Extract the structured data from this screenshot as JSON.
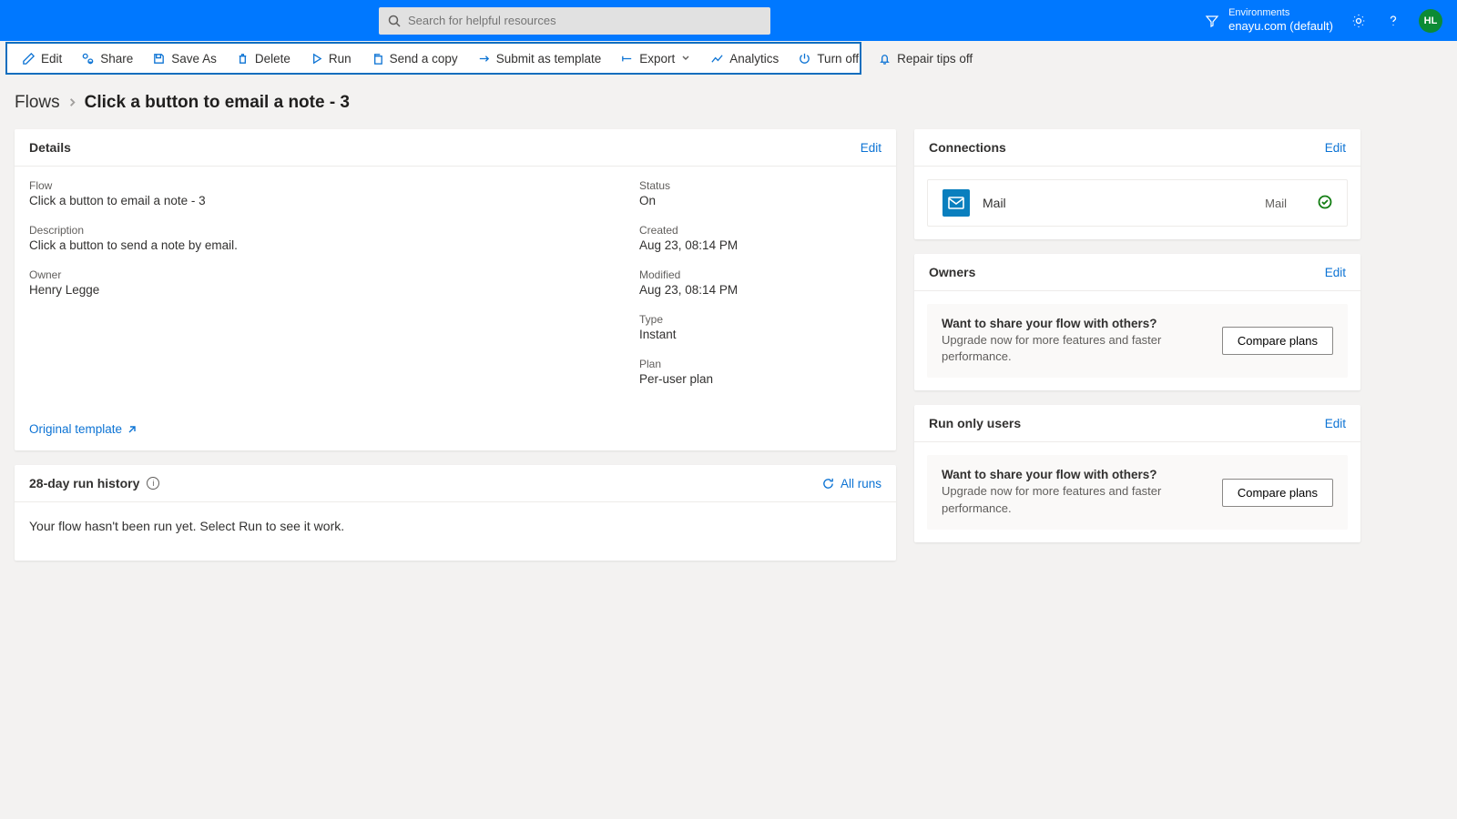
{
  "header": {
    "search_placeholder": "Search for helpful resources",
    "env_label": "Environments",
    "env_name": "enayu.com (default)",
    "avatar_initials": "HL"
  },
  "toolbar": {
    "edit": "Edit",
    "share": "Share",
    "save_as": "Save As",
    "delete": "Delete",
    "run": "Run",
    "send_copy": "Send a copy",
    "submit_template": "Submit as template",
    "export": "Export",
    "analytics": "Analytics",
    "turn_off": "Turn off",
    "repair": "Repair tips off"
  },
  "breadcrumb": {
    "root": "Flows",
    "current": "Click a button to email a note - 3"
  },
  "details": {
    "title": "Details",
    "edit": "Edit",
    "flow_label": "Flow",
    "flow_value": "Click a button to email a note - 3",
    "desc_label": "Description",
    "desc_value": "Click a button to send a note by email.",
    "owner_label": "Owner",
    "owner_value": "Henry Legge",
    "status_label": "Status",
    "status_value": "On",
    "created_label": "Created",
    "created_value": "Aug 23, 08:14 PM",
    "modified_label": "Modified",
    "modified_value": "Aug 23, 08:14 PM",
    "type_label": "Type",
    "type_value": "Instant",
    "plan_label": "Plan",
    "plan_value": "Per-user plan",
    "original_template": "Original template"
  },
  "run_history": {
    "title": "28-day run history",
    "all_runs": "All runs",
    "empty_prefix": "Your flow hasn't been run yet. Select ",
    "empty_link": "Run",
    "empty_suffix": " to see it work."
  },
  "connections": {
    "title": "Connections",
    "edit": "Edit",
    "items": [
      {
        "name": "Mail",
        "type": "Mail"
      }
    ]
  },
  "owners_card": {
    "title": "Owners",
    "edit": "Edit"
  },
  "run_only_card": {
    "title": "Run only users",
    "edit": "Edit"
  },
  "promo": {
    "title": "Want to share your flow with others?",
    "desc": "Upgrade now for more features and faster performance.",
    "button": "Compare plans"
  }
}
